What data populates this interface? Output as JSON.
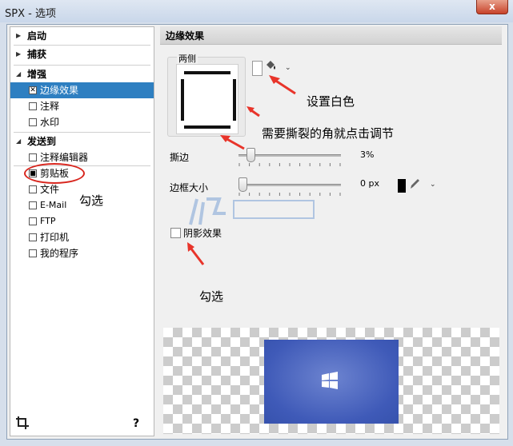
{
  "window": {
    "title": "SPX - 选项",
    "close_label": "x"
  },
  "sidebar": {
    "items": [
      {
        "type": "group",
        "label": "启动"
      },
      {
        "type": "group",
        "label": "捕获"
      },
      {
        "type": "group",
        "label": "增强"
      },
      {
        "type": "option",
        "label": "边缘效果",
        "checked": true,
        "selected": true
      },
      {
        "type": "option",
        "label": "注释",
        "checked": false
      },
      {
        "type": "option",
        "label": "水印",
        "checked": false
      },
      {
        "type": "group",
        "label": "发送到"
      },
      {
        "type": "option",
        "label": "注释编辑器",
        "checked": false
      },
      {
        "type": "option",
        "label": "剪贴板",
        "checked": true
      },
      {
        "type": "option",
        "label": "文件",
        "checked": false
      },
      {
        "type": "option",
        "label": "E-Mail",
        "checked": false
      },
      {
        "type": "option",
        "label": "FTP",
        "checked": false
      },
      {
        "type": "option",
        "label": "打印机",
        "checked": false
      },
      {
        "type": "option",
        "label": "我的程序",
        "checked": false
      }
    ],
    "crop_icon": "crop-icon",
    "help_label": "?"
  },
  "panel": {
    "title": "边缘效果",
    "edge_group_label": "两侧",
    "tear_label": "撕边",
    "tear_value": "3%",
    "tear_fraction": 0.03,
    "border_label": "边框大小",
    "border_value": "0 px",
    "border_color": "#000000",
    "shadow_label": "阴影效果",
    "shadow_checked": false
  },
  "annotations": {
    "set_white": "设置白色",
    "tear_hint": "需要撕裂的角就点击调节",
    "check_left": "勾选",
    "check_bottom": "勾选"
  },
  "colors": {
    "selection": "#2e7fc1",
    "annotation_red": "#d8261e",
    "preview_blue": "#3f5ab8"
  }
}
